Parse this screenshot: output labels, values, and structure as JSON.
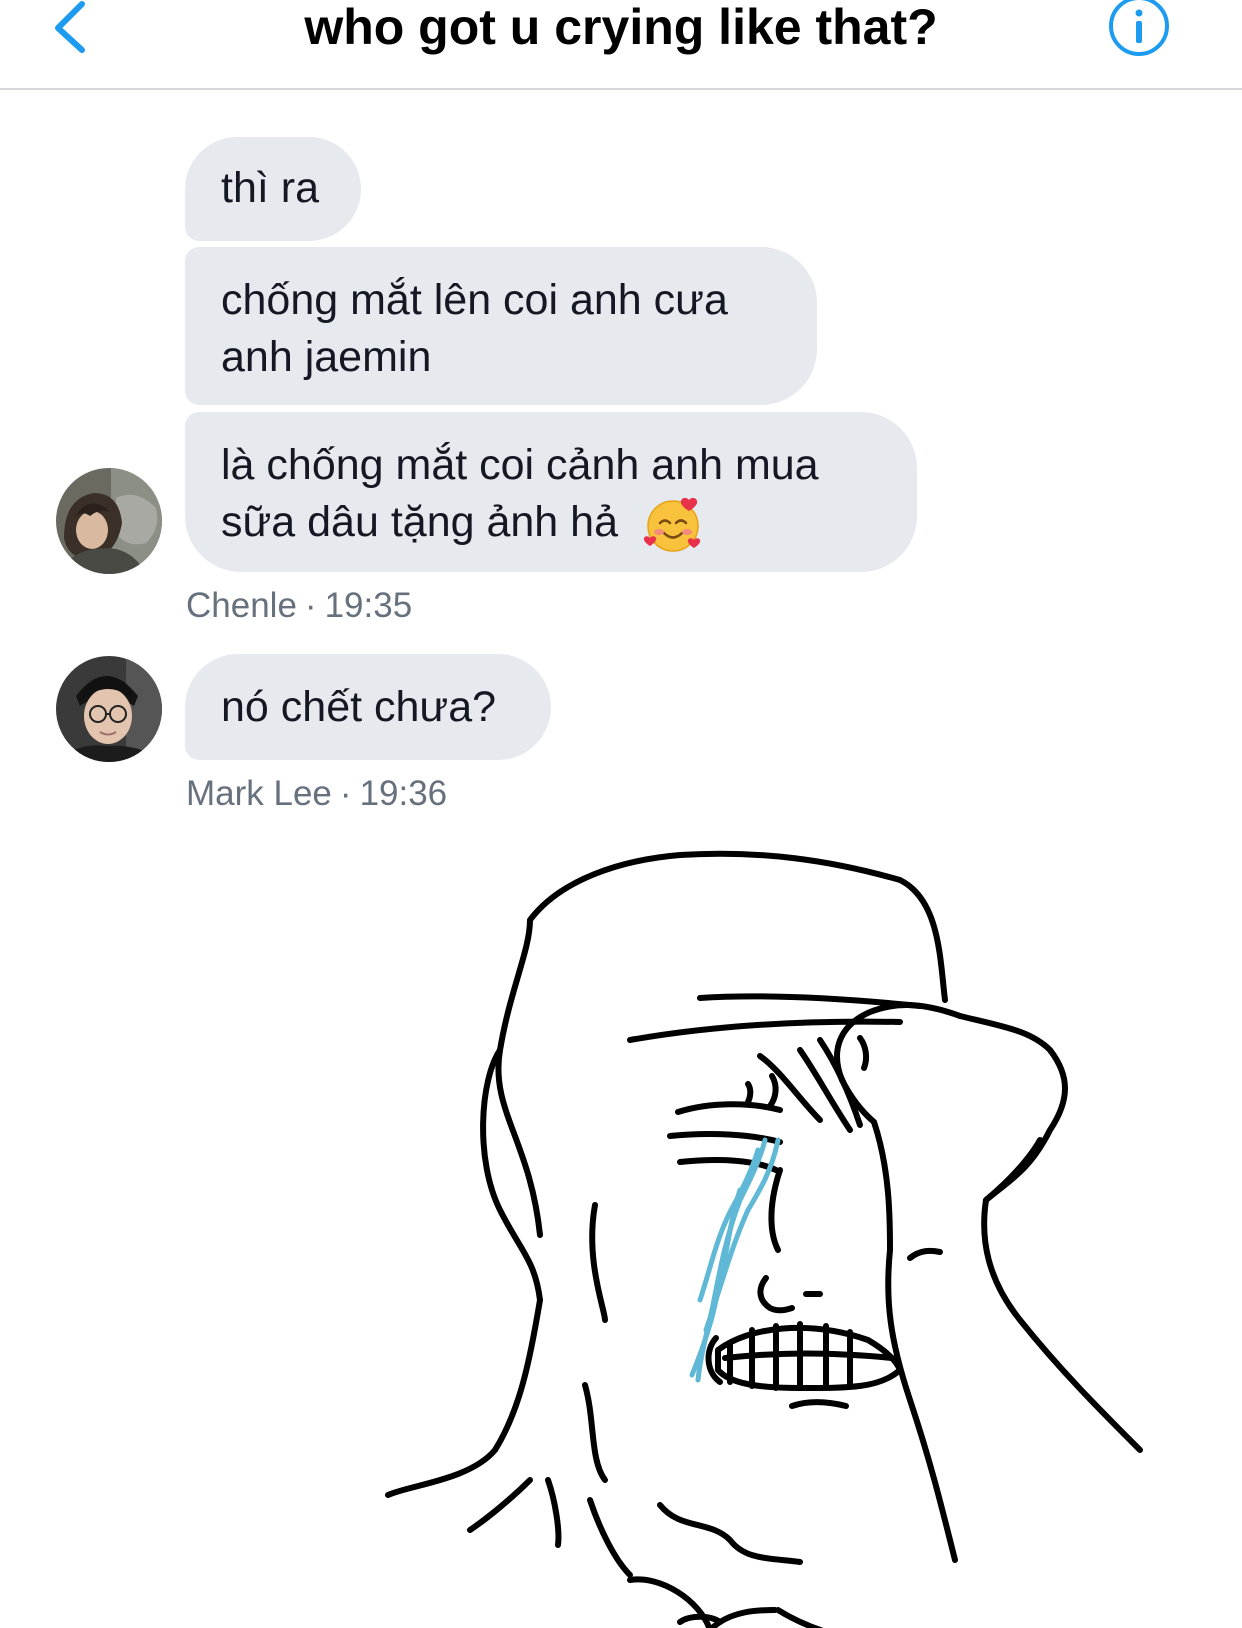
{
  "header": {
    "title": "who got u crying like that?",
    "back_icon": "chevron-left-icon",
    "info_icon": "info-icon",
    "accent_color": "#1d9bf0"
  },
  "messages": [
    {
      "sender": "Chenle",
      "time": "19:35",
      "bubbles": [
        "thì ra",
        [
          "chống mắt lên coi anh cưa",
          "anh jaemin"
        ],
        [
          "là chống mắt coi cảnh anh mua",
          "sữa dâu tặng ảnh hả"
        ]
      ],
      "emoji": "🥰"
    },
    {
      "sender": "Mark Lee",
      "time": "19:36",
      "bubbles": [
        "nó chết chưa?"
      ]
    }
  ],
  "meta_separator": "·",
  "colors": {
    "bubble_background": "#e6e9ee",
    "bubble_text": "#141823",
    "meta_text": "#67717d",
    "tear": "#5fb8d6"
  }
}
